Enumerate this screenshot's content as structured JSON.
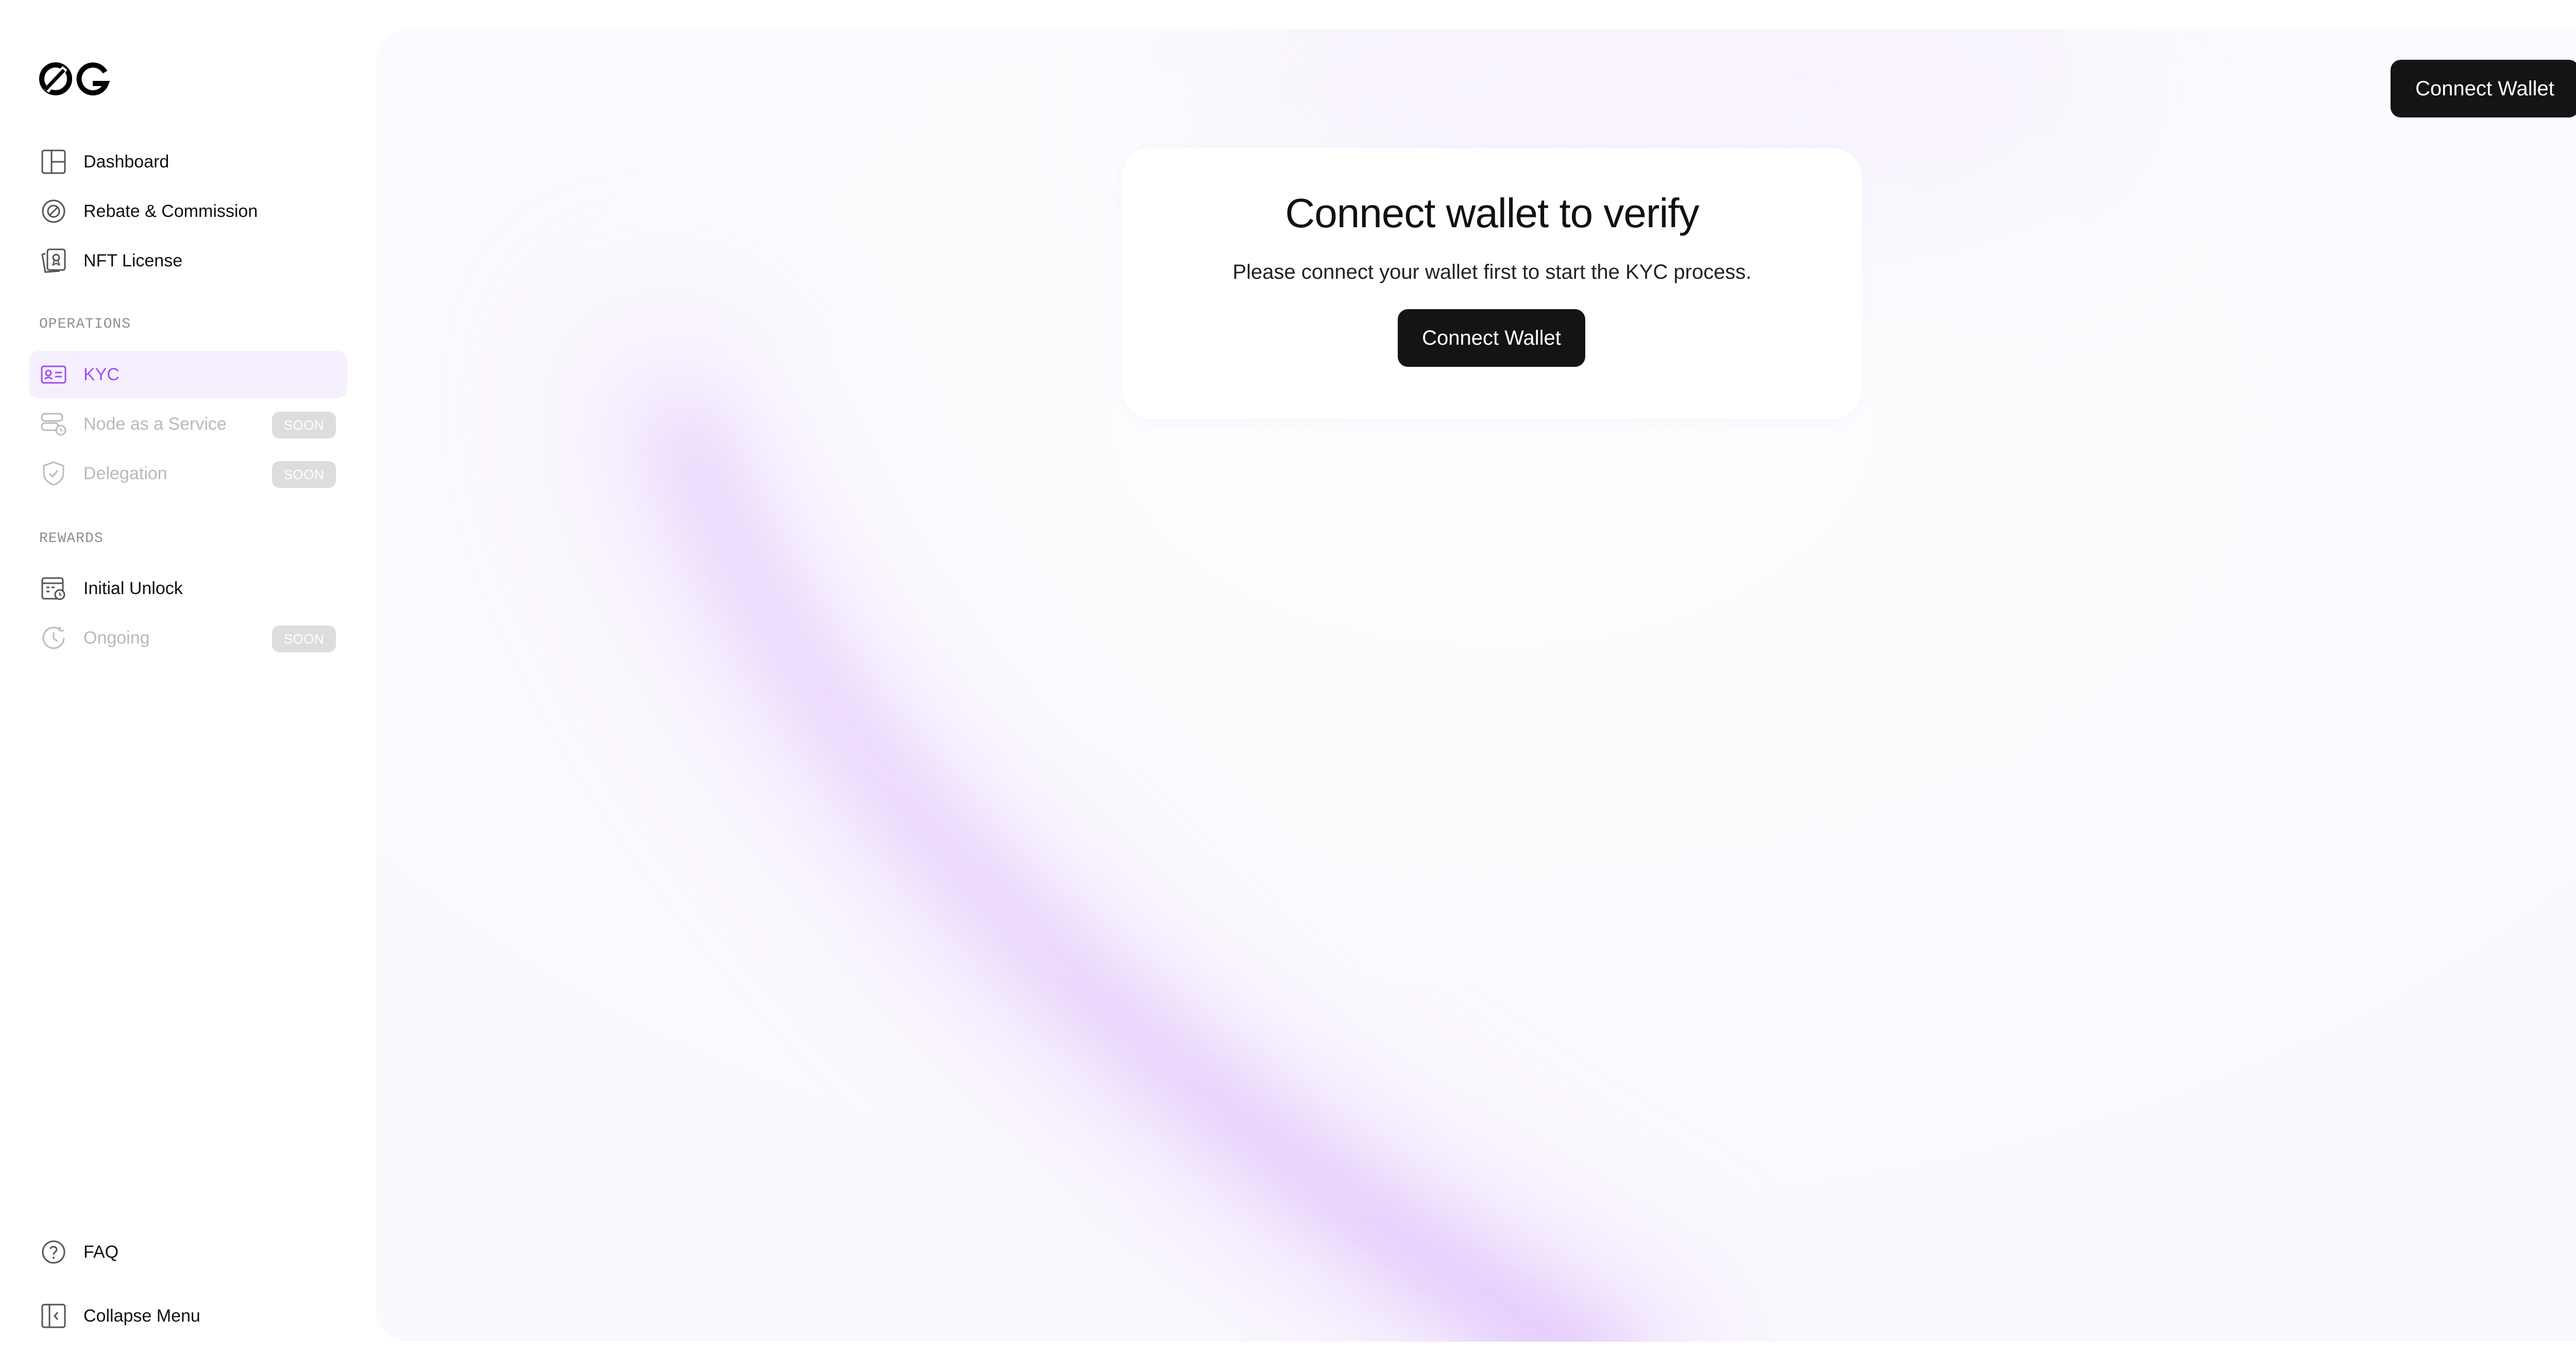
{
  "sidebar": {
    "logo_text": "0G",
    "items": [
      {
        "label": "Dashboard",
        "icon": "dashboard-icon"
      },
      {
        "label": "Rebate & Commission",
        "icon": "rebate-icon"
      },
      {
        "label": "NFT License",
        "icon": "nft-license-icon"
      }
    ],
    "operations": {
      "title": "OPERATIONS",
      "items": [
        {
          "label": "KYC",
          "icon": "id-card-icon",
          "state": "active"
        },
        {
          "label": "Node as a Service",
          "icon": "node-service-icon",
          "badge": "SOON",
          "state": "disabled"
        },
        {
          "label": "Delegation",
          "icon": "shield-check-icon",
          "badge": "SOON",
          "state": "disabled"
        }
      ]
    },
    "rewards": {
      "title": "REWARDS",
      "items": [
        {
          "label": "Initial Unlock",
          "icon": "calendar-unlock-icon"
        },
        {
          "label": "Ongoing",
          "icon": "clock-refresh-icon",
          "badge": "SOON",
          "state": "disabled"
        }
      ]
    },
    "faq_label": "FAQ",
    "collapse_label": "Collapse Menu"
  },
  "header": {
    "connect_label": "Connect Wallet"
  },
  "card": {
    "title": "Connect wallet to verify",
    "description": "Please connect your wallet first to start the KYC process.",
    "connect_label": "Connect Wallet"
  },
  "colors": {
    "accent": "#a04ff2",
    "active_bg": "#f6effe",
    "button_bg": "#141414",
    "main_bg": "#fbf9fe",
    "badge_bg": "#dddddd",
    "disabled_text": "#b9b9b9"
  }
}
